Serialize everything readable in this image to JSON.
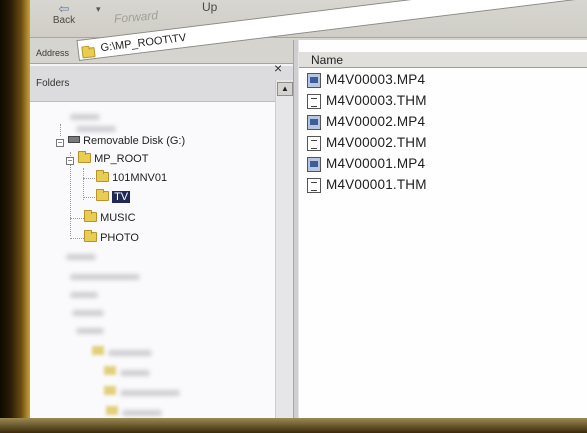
{
  "toolbar": {
    "back_label": "Back",
    "forward_label": "Forward",
    "up_label": "Up",
    "back_glyph": "⇦",
    "dropdown_glyph": "▾"
  },
  "address": {
    "label": "Address",
    "value": "G:\\MP_ROOT\\TV"
  },
  "folders_pane": {
    "title": "Folders",
    "close_glyph": "×",
    "scroll_up_glyph": "▲",
    "tree": {
      "drive": {
        "label": "Removable Disk (G:)",
        "expander": "−"
      },
      "mp_root": {
        "label": "MP_ROOT",
        "expander": "−"
      },
      "folder_101": {
        "label": "101MNV01"
      },
      "folder_tv": {
        "label": "TV",
        "selected": true
      },
      "folder_music": {
        "label": "MUSIC"
      },
      "folder_photo": {
        "label": "PHOTO"
      }
    }
  },
  "file_list": {
    "column_header": "Name",
    "files": [
      {
        "name": "M4V00003.MP4",
        "type": "mp4-video-icon"
      },
      {
        "name": "M4V00003.THM",
        "type": "thm-file-icon"
      },
      {
        "name": "M4V00002.MP4",
        "type": "mp4-video-icon"
      },
      {
        "name": "M4V00002.THM",
        "type": "thm-file-icon"
      },
      {
        "name": "M4V00001.MP4",
        "type": "mp4-video-icon"
      },
      {
        "name": "M4V00001.THM",
        "type": "thm-file-icon"
      }
    ]
  },
  "colors": {
    "selection": "#20285a",
    "folder": "#e9cd52",
    "monitor_bezel": "#c9a239"
  }
}
